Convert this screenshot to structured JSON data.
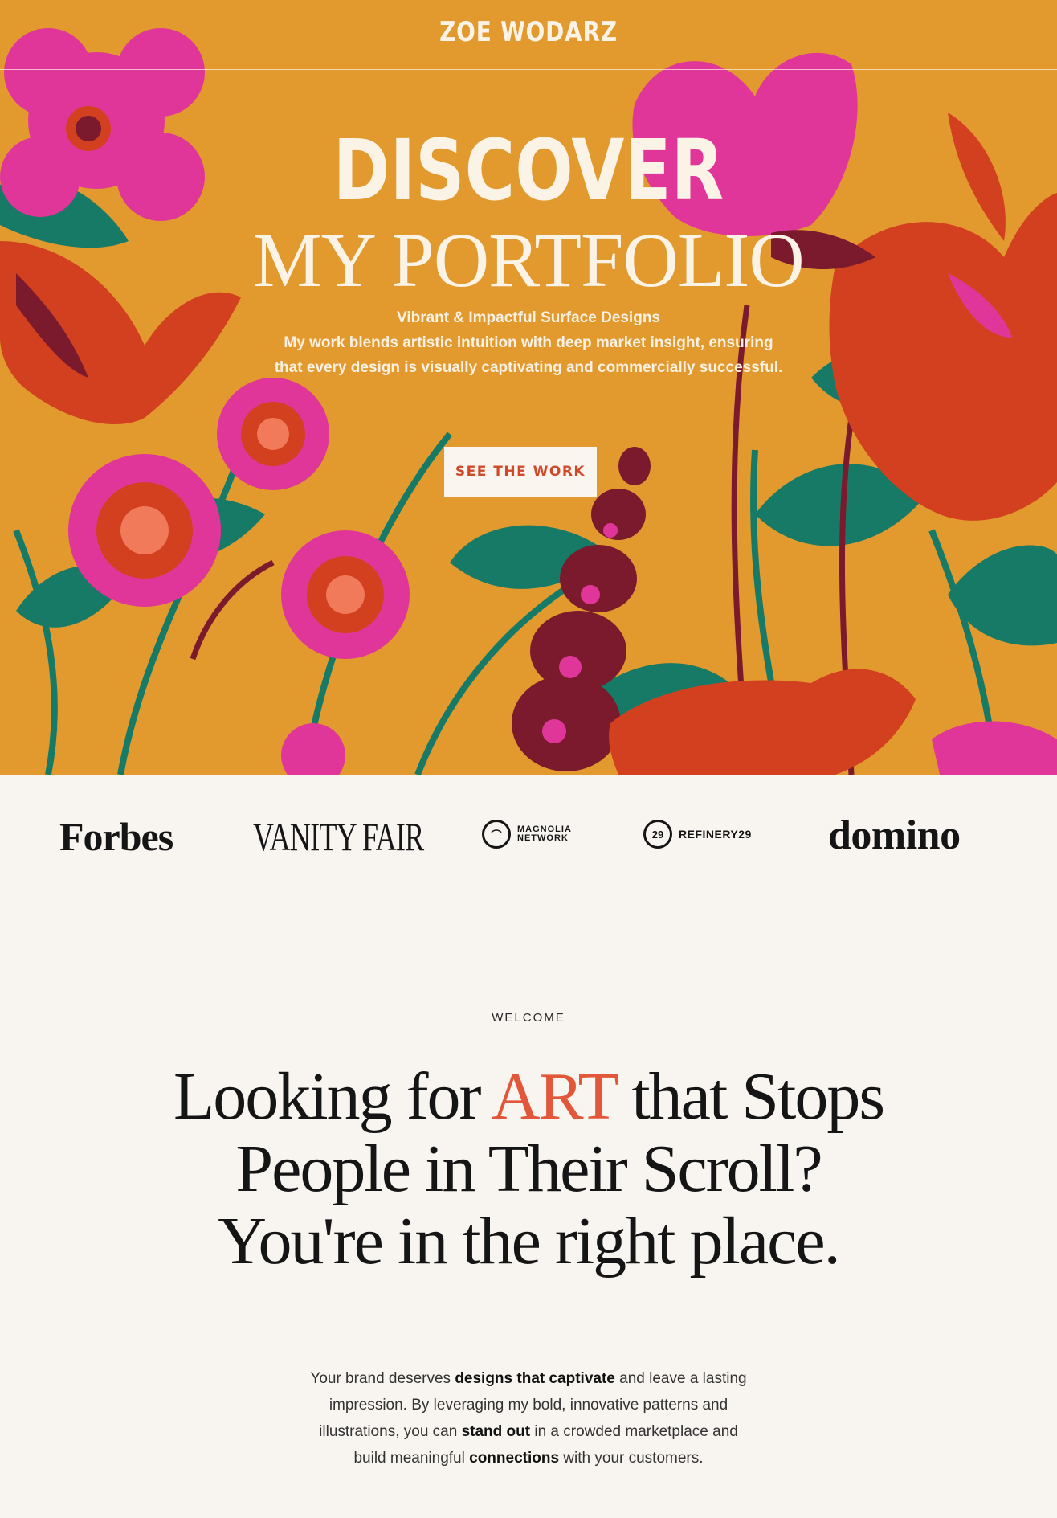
{
  "header": {
    "site_name": "ZOE WODARZ"
  },
  "hero": {
    "title_line1": "DISCOVER",
    "title_line2": "MY PORTFOLIO",
    "subtitle": "Vibrant & Impactful Surface Designs",
    "description_line1": "My work blends artistic intuition with deep market insight, ensuring",
    "description_line2": "that every design is visually captivating and commercially successful.",
    "cta_label": "SEE THE WORK",
    "colors": {
      "background": "#e29a2f",
      "magenta": "#e0369a",
      "red": "#d2401f",
      "teal": "#177a66",
      "maroon": "#7a1a2c",
      "cta_text": "#d04a2a"
    }
  },
  "press": {
    "logos": [
      "Forbes",
      "VANITY FAIR",
      "MAGNOLIA NETWORK",
      "REFINERY29",
      "domino"
    ],
    "magnolia_line1": "MAGNOLIA",
    "magnolia_line2": "NETWORK",
    "r29_mark": "29",
    "r29_text": "REFINERY29"
  },
  "welcome": {
    "eyebrow": "WELCOME",
    "headline_pre": "Looking for",
    "headline_accent": "ART",
    "headline_post": "that Stops",
    "headline_line2": "People in Their Scroll?",
    "headline_line3": "You're in the right place.",
    "accent_color": "#e2573a",
    "body": {
      "t1": "Your brand deserves ",
      "b1": "designs that captivate",
      "t2": " and leave a lasting impression. By leveraging my bold, innovative patterns and illustrations, you can ",
      "b2": "stand out",
      "t3": " in a crowded marketplace and build meaningful ",
      "b3": "connections",
      "t4": " with your customers."
    }
  }
}
